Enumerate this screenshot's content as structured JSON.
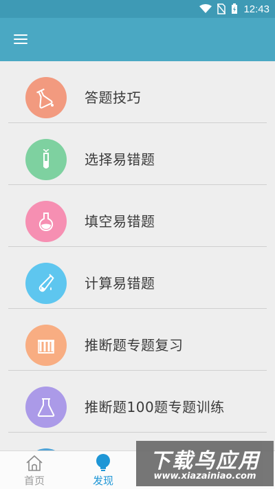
{
  "status_bar": {
    "time": "12:43"
  },
  "list": {
    "items": [
      {
        "label": "答题技巧",
        "icon": "flask-pour-icon",
        "color": "#f29a7f"
      },
      {
        "label": "选择易错题",
        "icon": "test-tube-icon",
        "color": "#7ed1a0"
      },
      {
        "label": "填空易错题",
        "icon": "round-flask-icon",
        "color": "#f68fb2"
      },
      {
        "label": "计算易错题",
        "icon": "pipette-icon",
        "color": "#5ec6ef"
      },
      {
        "label": "推断题专题复习",
        "icon": "test-tube-rack-icon",
        "color": "#f8ad82"
      },
      {
        "label": "推断题100题专题训练",
        "icon": "beaker-icon",
        "color": "#ab9ae8"
      },
      {
        "label": "",
        "icon": "partial-icon",
        "color": "#4ea3d8"
      }
    ]
  },
  "tabbar": {
    "tabs": [
      {
        "label": "首页",
        "icon": "home-icon",
        "color": "#9a9a9a"
      },
      {
        "label": "发现",
        "icon": "lightbulb-icon",
        "color": "#1e96d6"
      }
    ]
  },
  "watermark": {
    "title": "下载鸟应用",
    "url": "www.xiazainiao.com"
  }
}
